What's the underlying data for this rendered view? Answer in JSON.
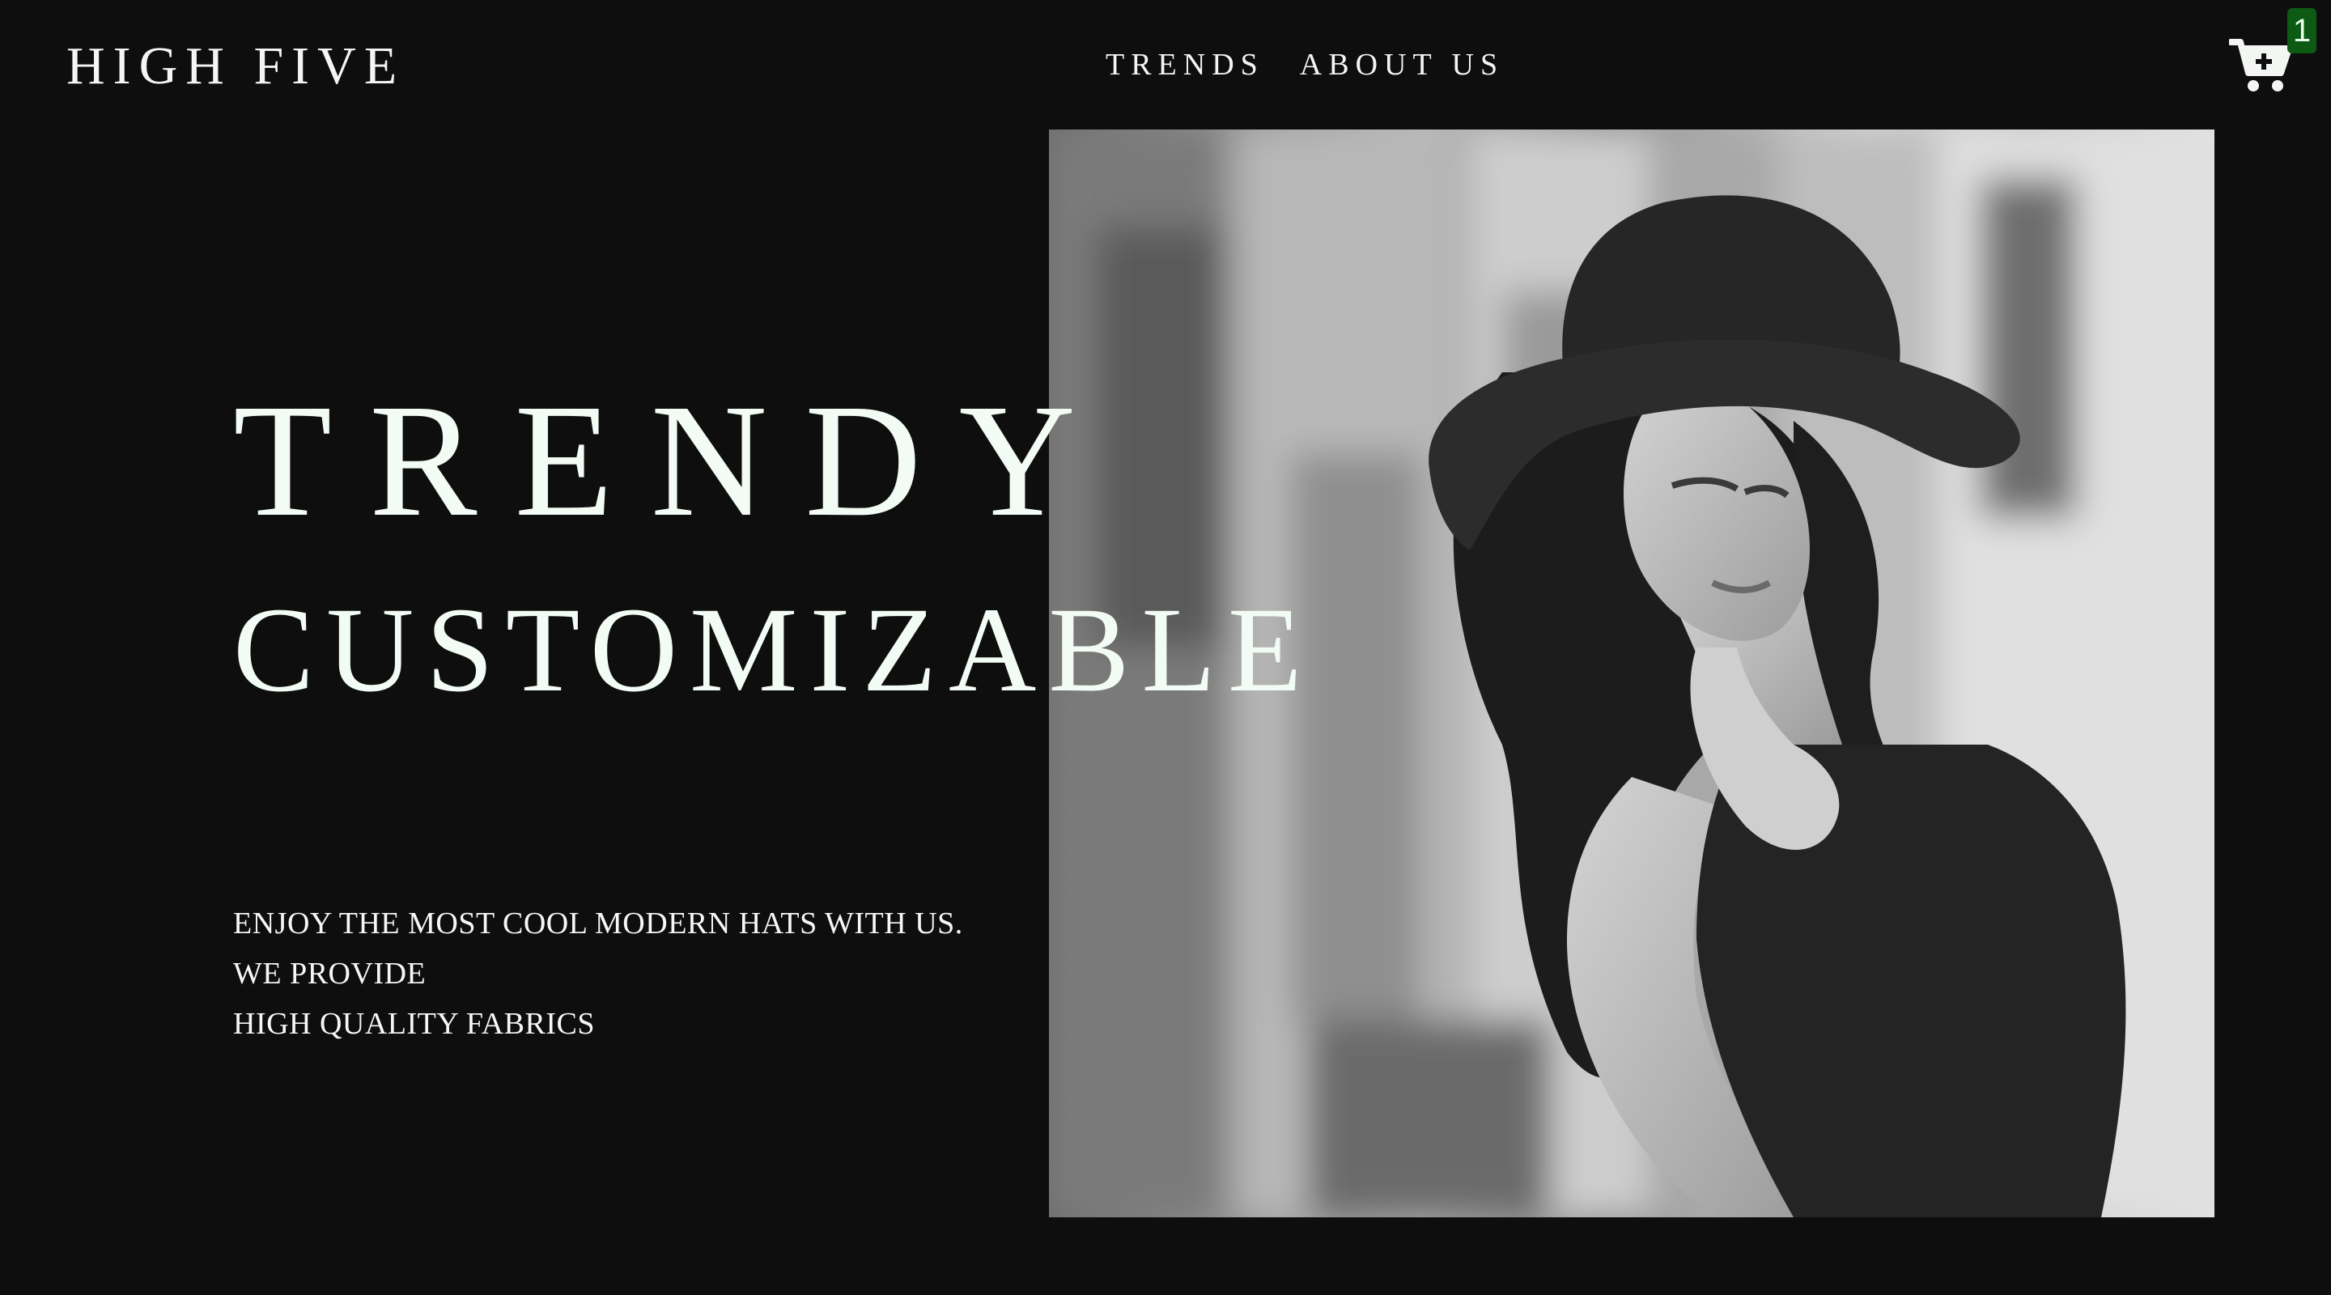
{
  "header": {
    "brand": "HIGH FIVE",
    "nav": [
      {
        "label": "TRENDS"
      },
      {
        "label": "ABOUT US"
      }
    ],
    "cart": {
      "icon": "cart-plus-icon",
      "count": "1",
      "badge_color": "#0c5a14"
    }
  },
  "hero": {
    "title": "TRENDY",
    "subtitle": "CUSTOMIZABLE",
    "tagline": [
      "ENJOY THE MOST COOL MODERN HATS WITH US.",
      "WE PROVIDE",
      "HIGH QUALITY FABRICS"
    ],
    "image": "woman-in-hat-photo"
  },
  "colors": {
    "background": "#0e0e0f",
    "text": "#f2fbf4"
  }
}
